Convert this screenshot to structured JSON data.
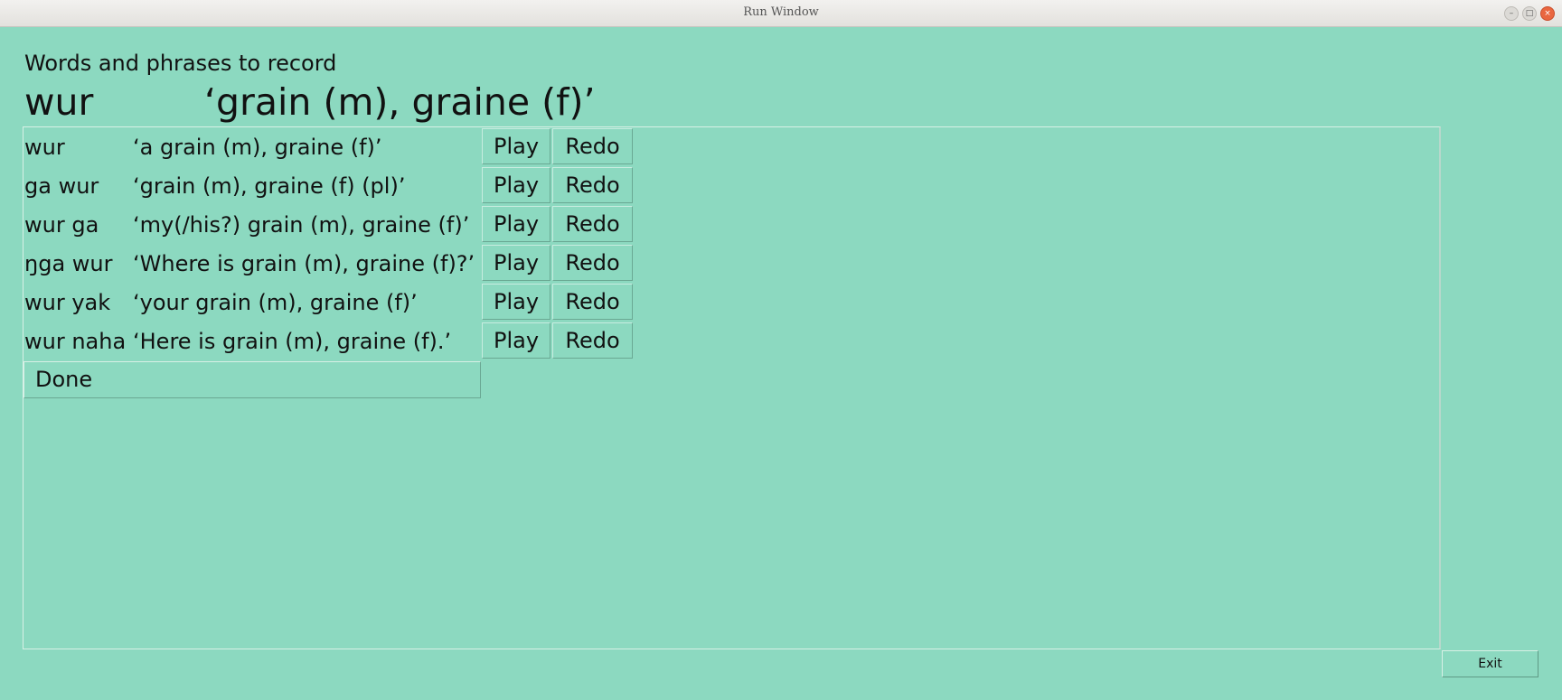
{
  "window": {
    "title": "Run Window",
    "minimize_glyph": "–",
    "maximize_glyph": "□",
    "close_glyph": "×"
  },
  "heading": "Words and phrases to record",
  "current": {
    "word": "wur",
    "gloss": "‘grain (m), graine (f)’"
  },
  "rows": [
    {
      "word": "wur",
      "gloss": "‘a grain (m), graine (f)’",
      "play": "Play",
      "redo": "Redo"
    },
    {
      "word": "ga wur",
      "gloss": "‘grain (m), graine (f) (pl)’",
      "play": "Play",
      "redo": "Redo"
    },
    {
      "word": "wur ga",
      "gloss": "‘my(/his?) grain (m), graine (f)’",
      "play": "Play",
      "redo": "Redo"
    },
    {
      "word": "ŋga wur",
      "gloss": "‘Where is grain (m), graine (f)?’",
      "play": "Play",
      "redo": "Redo"
    },
    {
      "word": "wur yak",
      "gloss": "‘your grain (m), graine (f)’",
      "play": "Play",
      "redo": "Redo"
    },
    {
      "word": "wur naha",
      "gloss": "‘Here is grain (m), graine (f).’",
      "play": "Play",
      "redo": "Redo"
    }
  ],
  "done_label": "Done",
  "exit_label": "Exit",
  "colors": {
    "background": "#8cd9c0",
    "close_button": "#e9663f"
  }
}
